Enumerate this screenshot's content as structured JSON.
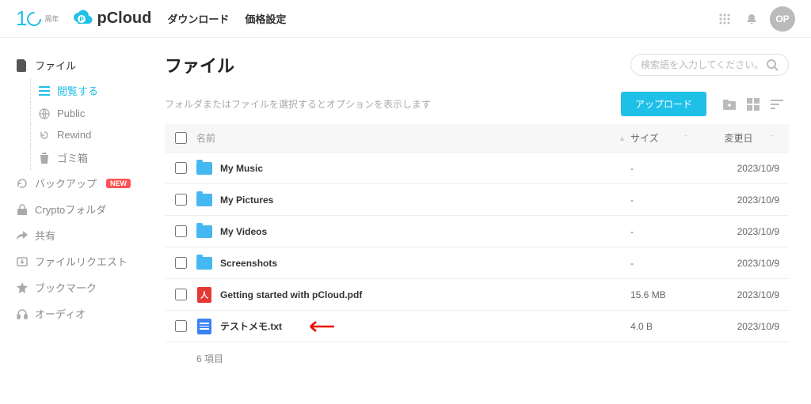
{
  "header": {
    "anniversary_text": "周年",
    "brand": "pCloud",
    "links": [
      "ダウンロード",
      "価格設定"
    ],
    "avatar_initials": "OP"
  },
  "sidebar": {
    "files_label": "ファイル",
    "children": [
      {
        "label": "閲覧する",
        "icon": "list-icon",
        "active": true
      },
      {
        "label": "Public",
        "icon": "globe-icon"
      },
      {
        "label": "Rewind",
        "icon": "rewind-icon"
      },
      {
        "label": "ゴミ箱",
        "icon": "trash-icon"
      }
    ],
    "items": [
      {
        "label": "バックアップ",
        "icon": "backup-icon",
        "badge": "NEW"
      },
      {
        "label": "Cryptoフォルダ",
        "icon": "lock-icon"
      },
      {
        "label": "共有",
        "icon": "share-icon"
      },
      {
        "label": "ファイルリクエスト",
        "icon": "request-icon"
      },
      {
        "label": "ブックマーク",
        "icon": "star-icon"
      },
      {
        "label": "オーディオ",
        "icon": "audio-icon"
      }
    ]
  },
  "main": {
    "title": "ファイル",
    "search_placeholder": "検索語を入力してください。",
    "hint": "フォルダまたはファイルを選択するとオプションを表示します",
    "upload_label": "アップロード",
    "columns": {
      "name": "名前",
      "size": "サイズ",
      "modified": "変更日"
    },
    "rows": [
      {
        "kind": "folder",
        "name": "My Music",
        "size": "-",
        "modified": "2023/10/9"
      },
      {
        "kind": "folder",
        "name": "My Pictures",
        "size": "-",
        "modified": "2023/10/9"
      },
      {
        "kind": "folder",
        "name": "My Videos",
        "size": "-",
        "modified": "2023/10/9"
      },
      {
        "kind": "folder",
        "name": "Screenshots",
        "size": "-",
        "modified": "2023/10/9"
      },
      {
        "kind": "pdf",
        "name": "Getting started with pCloud.pdf",
        "size": "15.6 MB",
        "modified": "2023/10/9"
      },
      {
        "kind": "txt",
        "name": "テストメモ.txt",
        "size": "4.0 B",
        "modified": "2023/10/9",
        "annotated": true
      }
    ],
    "count_text": "6 項目"
  }
}
